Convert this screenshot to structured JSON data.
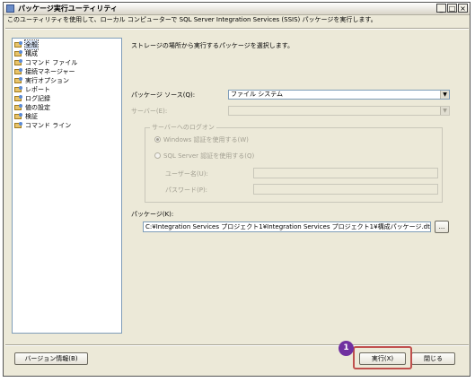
{
  "window": {
    "title": "パッケージ実行ユーティリティ",
    "controls": {
      "minimize": "_",
      "maximize": "□",
      "close": "×"
    }
  },
  "description": "このユーティリティを使用して、ローカル コンピューターで SQL Server Integration Services (SSIS) パッケージを実行します。",
  "sidebar": {
    "items": [
      {
        "label": "全般",
        "selected": true
      },
      {
        "label": "構成"
      },
      {
        "label": "コマンド ファイル"
      },
      {
        "label": "接続マネージャー"
      },
      {
        "label": "実行オプション"
      },
      {
        "label": "レポート"
      },
      {
        "label": "ログ記録"
      },
      {
        "label": "値の設定"
      },
      {
        "label": "検証"
      },
      {
        "label": "コマンド ライン"
      }
    ]
  },
  "main": {
    "prompt": "ストレージの場所から実行するパッケージを選択します。",
    "package_source": {
      "label": "パッケージ ソース(Q):",
      "value": "ファイル システム"
    },
    "server": {
      "label": "サーバー(E):",
      "value": ""
    },
    "logon": {
      "title": "サーバーへのログオン",
      "windows_auth": "Windows 認証を使用する(W)",
      "sql_auth": "SQL Server 認証を使用する(Q)",
      "username_label": "ユーザー名(U):",
      "password_label": "パスワード(P):"
    },
    "package": {
      "label": "パッケージ(K):",
      "value": "C:¥Integration Services プロジェクト1¥Integration Services プロジェクト1¥構成パッケージ.dtsx",
      "browse": "..."
    }
  },
  "footer": {
    "version_button": "バージョン情報(B)",
    "execute_button": "実行(X)",
    "close_button": "閉じる"
  },
  "annotation": {
    "badge": "1",
    "color": "#c0504d",
    "badge_color": "#7030a0"
  }
}
